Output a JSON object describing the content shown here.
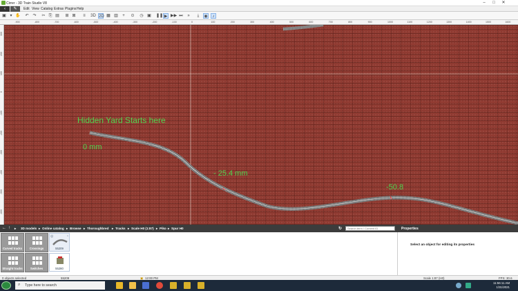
{
  "window": {
    "title": "Cirrer - 3D Train Studio V8"
  },
  "menu": {
    "items": [
      "Edit",
      "View",
      "Catalog",
      "Extras",
      "Plugins",
      "Help"
    ]
  },
  "ruler": {
    "top_labels": [
      "-1000",
      "-900",
      "-800",
      "-700",
      "-600",
      "-500",
      "-400",
      "-300",
      "-200",
      "-100",
      "0",
      "100",
      "200",
      "300",
      "400",
      "500",
      "600",
      "700",
      "800",
      "900",
      "1000",
      "1100",
      "1200",
      "1300",
      "1400",
      "1500",
      "1600"
    ],
    "left_labels": [
      "300",
      "200",
      "100",
      "0",
      "-100",
      "-200",
      "-300",
      "-400",
      "-500",
      "-600"
    ]
  },
  "canvas": {
    "annotations": {
      "hidden_yard": "Hidden Yard Starts here",
      "zero": "0 mm",
      "minus_25": "- 25.4 mm",
      "minus_50": "-50.8"
    }
  },
  "breadcrumb": [
    "3D models",
    "Online catalog",
    "Browse",
    "Thoroughbred",
    "Tracks",
    "Scale H0 (1:87)",
    "Piko",
    "Spur H0"
  ],
  "search": {
    "placeholder": "Search term / Content ID"
  },
  "catalog": {
    "categories": [
      "Curved tracks",
      "Crossings",
      "Straight tracks",
      "Switches"
    ],
    "items": [
      "55209",
      "55280"
    ]
  },
  "properties": {
    "header": "Properties",
    "empty_message": "Select an object for editing its properties"
  },
  "status": {
    "selection": "0 objects selected",
    "item_id": "55209",
    "time": "12:00 PM",
    "scale": "Scale 1:87 (H0)",
    "fps": "FPS: 30.6"
  },
  "taskbar": {
    "search_placeholder": "Type here to search",
    "clock_time": "11:56:11 AM",
    "clock_date": "1/31/2021"
  },
  "colors": {
    "annotation": "#4fd44f",
    "canvas": "#8f3a31",
    "panel_header": "#3c3c3c"
  }
}
